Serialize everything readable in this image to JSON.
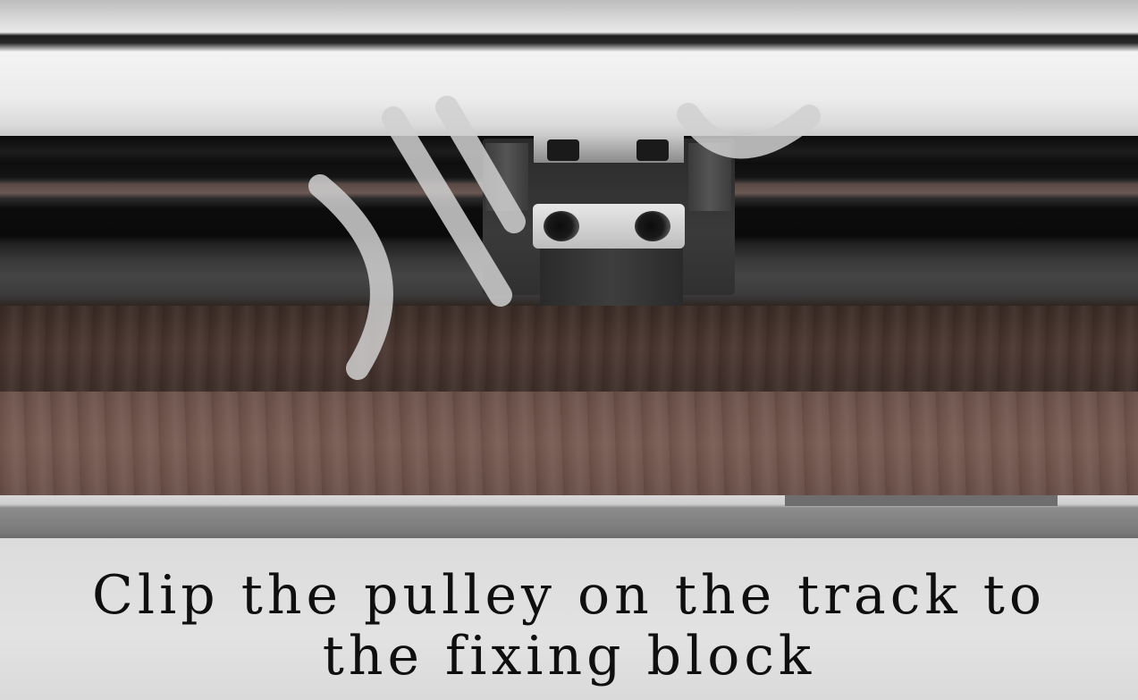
{
  "caption": {
    "line1": "Clip the pulley on the track to",
    "line2": "the fixing block"
  },
  "colors": {
    "wood": "#6b5149",
    "rail": "#e9e9e9",
    "caption_text": "#0f0f0f"
  }
}
